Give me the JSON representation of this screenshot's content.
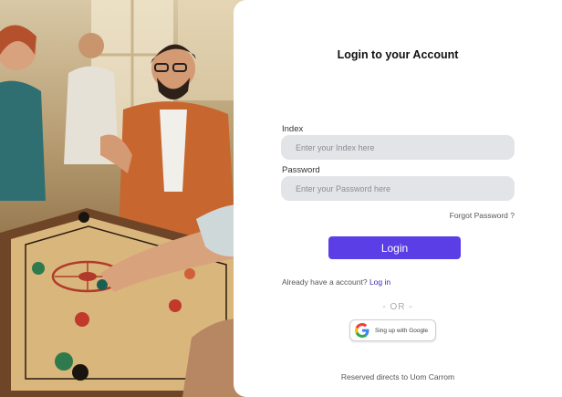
{
  "hero": {
    "icon": "carrom-players-illustration"
  },
  "login": {
    "title": "Login to your Account",
    "index_label": "Index",
    "index_placeholder": "Enter your Index here",
    "password_label": "Password",
    "password_placeholder": "Enter your Password here",
    "forgot_password": "Forgot Password ?",
    "login_button": "Login",
    "already_text": "Already have a account?",
    "login_link": "Log in",
    "or_divider": "- OR -",
    "google_button": "Sing up with Google",
    "footer": "Reserved directs to Uom Carrom"
  },
  "colors": {
    "accent": "#5b3ee6",
    "field_bg": "#e2e4e8",
    "link": "#3b2bb8"
  }
}
